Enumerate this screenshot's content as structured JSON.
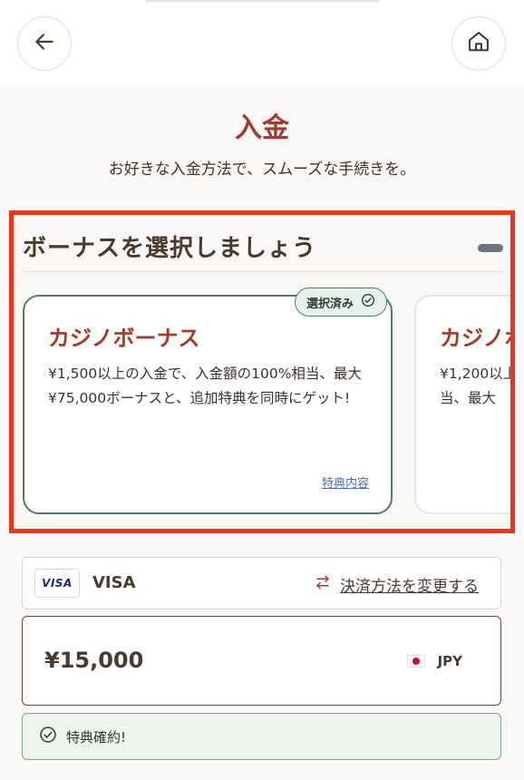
{
  "header": {
    "back_icon": "arrow-left-icon",
    "home_icon": "home-icon"
  },
  "page": {
    "title": "入金",
    "subtitle": "お好きな入金方法で、スムーズな手続きを。"
  },
  "bonus": {
    "heading": "ボーナスを選択しましょう",
    "cards": [
      {
        "title": "カジノボーナス",
        "description": "¥1,500以上の入金で、入金額の100%相当、最大¥75,000ボーナスと、追加特典を同時にゲット!",
        "badge": "選択済み",
        "link": "特典内容",
        "selected": true
      },
      {
        "title": "カジノボーナス",
        "description": "¥1,200以上の入金で、\n当、最大",
        "selected": false
      }
    ]
  },
  "payment": {
    "method": "VISA",
    "logo_text": "VISA",
    "change_label": "決済方法を変更する",
    "change_icon": "swap-arrows-icon"
  },
  "amount": {
    "value": "¥15,000",
    "currency": "JPY",
    "flag_icon": "japan-flag-icon"
  },
  "benefit": {
    "label": "特典確約!",
    "icon": "check-circle-icon"
  },
  "colors": {
    "accent": "#a43a28",
    "selected_border": "#4f7d64",
    "highlight": "#e8361f"
  }
}
